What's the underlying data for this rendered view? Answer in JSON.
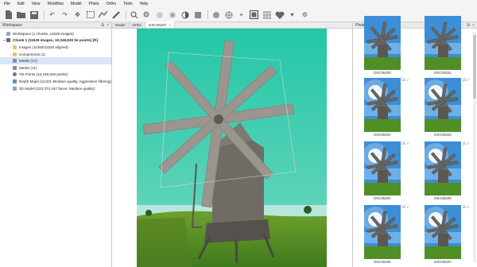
{
  "menu": [
    "File",
    "Edit",
    "View",
    "Workflow",
    "Model",
    "Photo",
    "Ortho",
    "Tools",
    "Help"
  ],
  "toolbar": {
    "icons": [
      "new-icon",
      "open-icon",
      "save-icon",
      "undo-icon",
      "redo-icon",
      "navigation-icon",
      "rectangle-selection-icon",
      "ruler-icon",
      "shape-icon",
      "zoom-in-icon",
      "zoom-out-icon",
      "reset-view-icon",
      "view-mode-icon",
      "points-icon",
      "shaded-icon",
      "solid-icon",
      "textured-icon",
      "tiled-icon",
      "cameras-icon",
      "settings-icon"
    ]
  },
  "workspace": {
    "title": "Workspace",
    "rows": [
      {
        "text": "Workspace (1 chunks, 11526 images)",
        "icon": "workspace-icon",
        "indent": 0,
        "bold": false,
        "twisty": "",
        "selected": false
      },
      {
        "text": "Chunk 1 (11526 images, 10,249,625 tie points) [R]",
        "icon": "chunk-icon",
        "indent": 0,
        "bold": true,
        "twisty": "▾",
        "selected": false
      },
      {
        "text": "Images (11450/11526 aligned)",
        "icon": "images-folder-icon",
        "indent": 1,
        "bold": false,
        "twisty": "›",
        "selected": false
      },
      {
        "text": "Components (1)",
        "icon": "components-folder-icon",
        "indent": 1,
        "bold": false,
        "twisty": "›",
        "selected": false
      },
      {
        "text": "Masks (17)",
        "icon": "masks-icon",
        "indent": 1,
        "bold": false,
        "twisty": "",
        "selected": true
      },
      {
        "text": "Masks (11)",
        "icon": "masks-icon",
        "indent": 1,
        "bold": false,
        "twisty": "",
        "selected": false
      },
      {
        "text": "Tie Points (10,249,625 points)",
        "icon": "tie-points-icon",
        "indent": 1,
        "bold": false,
        "twisty": "",
        "selected": false
      },
      {
        "text": "Depth Maps (11423, Medium quality, Aggressive filtering)",
        "icon": "depth-maps-icon",
        "indent": 1,
        "bold": false,
        "twisty": "",
        "selected": false
      },
      {
        "text": "3D Model (222,374,197 faces, Medium quality)",
        "icon": "model-icon",
        "indent": 1,
        "bold": false,
        "twisty": "",
        "selected": false
      }
    ]
  },
  "center": {
    "tabs": [
      {
        "label": "Model",
        "active": false
      },
      {
        "label": "Ortho",
        "active": false
      },
      {
        "label": "DSC05267",
        "active": true
      }
    ]
  },
  "photos": {
    "title": "Photos",
    "items": [
      {
        "label": "DSC05200",
        "mark": ""
      },
      {
        "label": "DSC05201",
        "mark": ""
      },
      {
        "label": "DSC05202",
        "mark": "☑ ✓"
      },
      {
        "label": "DSC05203",
        "mark": "☑ ✓"
      },
      {
        "label": "DSC05204",
        "mark": "☑ ✓"
      },
      {
        "label": "DSC05205",
        "mark": "☑ ✓"
      },
      {
        "label": "DSC05206",
        "mark": "☑ ✓"
      },
      {
        "label": "DSC05207",
        "mark": "☑ ✓"
      }
    ]
  }
}
